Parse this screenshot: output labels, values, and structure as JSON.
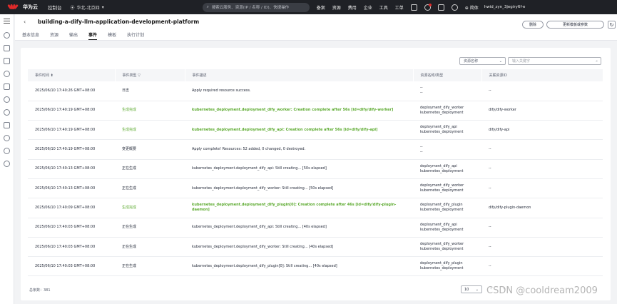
{
  "topbar": {
    "brand": "华为云",
    "console": "控制台",
    "region": "华北-北京四",
    "search_placeholder": "搜索云服务、资源(IP / 名称 / ID)、快捷操作",
    "nav": [
      "备案",
      "资源",
      "费用",
      "企业",
      "工具",
      "工单"
    ],
    "lang": "简体",
    "user": "hwid_zyn_3jegiry6f-e"
  },
  "header": {
    "title": "building-a-dify-llm-application-development-platform",
    "tabs": [
      "基本信息",
      "资源",
      "输出",
      "事件",
      "模板",
      "执行计划"
    ],
    "active_tab": "事件",
    "delete_label": "删除",
    "update_label": "更新模板或参数"
  },
  "filter": {
    "select_value": "资源名称",
    "input_placeholder": "输入关键字"
  },
  "table": {
    "columns": [
      "事件时间",
      "事件类型",
      "事件描述",
      "资源名称/类型",
      "关联资源ID"
    ],
    "rows": [
      {
        "time": "2025/06/10 17:40:26 GMT+08:00",
        "type": "日志",
        "desc": "Apply required resource success.",
        "res1": "--",
        "res2": "--",
        "id": "--",
        "status": "normal"
      },
      {
        "time": "2025/06/10 17:40:19 GMT+08:00",
        "type": "生成完成",
        "desc": "kubernetes_deployment.deployment_dify_worker: Creation complete after 56s [id=dify/dify-worker]",
        "res1": "deployment_dify_worker",
        "res2": "kubernetes_deployment",
        "id": "dify/dify-worker",
        "status": "success"
      },
      {
        "time": "2025/06/10 17:40:19 GMT+08:00",
        "type": "生成完成",
        "desc": "kubernetes_deployment.deployment_dify_api: Creation complete after 56s [id=dify/dify-api]",
        "res1": "deployment_dify_api",
        "res2": "kubernetes_deployment",
        "id": "dify/dify-api",
        "status": "success"
      },
      {
        "time": "2025/06/10 17:40:19 GMT+08:00",
        "type": "变更概要",
        "desc": "Apply complete! Resources: 52 added, 0 changed, 0 destroyed.",
        "res1": "--",
        "res2": "--",
        "id": "--",
        "status": "normal"
      },
      {
        "time": "2025/06/10 17:40:13 GMT+08:00",
        "type": "正在生成",
        "desc": "kubernetes_deployment.deployment_dify_api: Still creating... [50s elapsed]",
        "res1": "deployment_dify_api",
        "res2": "kubernetes_deployment",
        "id": "--",
        "status": "normal"
      },
      {
        "time": "2025/06/10 17:40:13 GMT+08:00",
        "type": "正在生成",
        "desc": "kubernetes_deployment.deployment_dify_worker: Still creating... [50s elapsed]",
        "res1": "deployment_dify_worker",
        "res2": "kubernetes_deployment",
        "id": "--",
        "status": "normal"
      },
      {
        "time": "2025/06/10 17:40:09 GMT+08:00",
        "type": "生成完成",
        "desc": "kubernetes_deployment.deployment_dify_plugin[0]: Creation complete after 46s [id=dify/dify-plugin-daemon]",
        "res1": "deployment_dify_plugin",
        "res2": "kubernetes_deployment",
        "id": "dify/dify-plugin-daemon",
        "status": "success"
      },
      {
        "time": "2025/06/10 17:40:03 GMT+08:00",
        "type": "正在生成",
        "desc": "kubernetes_deployment.deployment_dify_api: Still creating... [40s elapsed]",
        "res1": "deployment_dify_api",
        "res2": "kubernetes_deployment",
        "id": "--",
        "status": "normal"
      },
      {
        "time": "2025/06/10 17:40:03 GMT+08:00",
        "type": "正在生成",
        "desc": "kubernetes_deployment.deployment_dify_worker: Still creating... [40s elapsed]",
        "res1": "deployment_dify_worker",
        "res2": "kubernetes_deployment",
        "id": "--",
        "status": "normal"
      },
      {
        "time": "2025/06/10 17:40:03 GMT+08:00",
        "type": "正在生成",
        "desc": "kubernetes_deployment.deployment_dify_plugin[0]: Still creating... [40s elapsed]",
        "res1": "deployment_dify_plugin",
        "res2": "kubernetes_deployment",
        "id": "--",
        "status": "normal"
      }
    ]
  },
  "pagination": {
    "total": "总条数：381",
    "page_size": "10"
  },
  "colors": {
    "topbar_bg": "#1f2126",
    "success_green": "#5caa2f",
    "brand_red": "#e02a2a"
  },
  "watermark": "CSDN @cooldream2009"
}
